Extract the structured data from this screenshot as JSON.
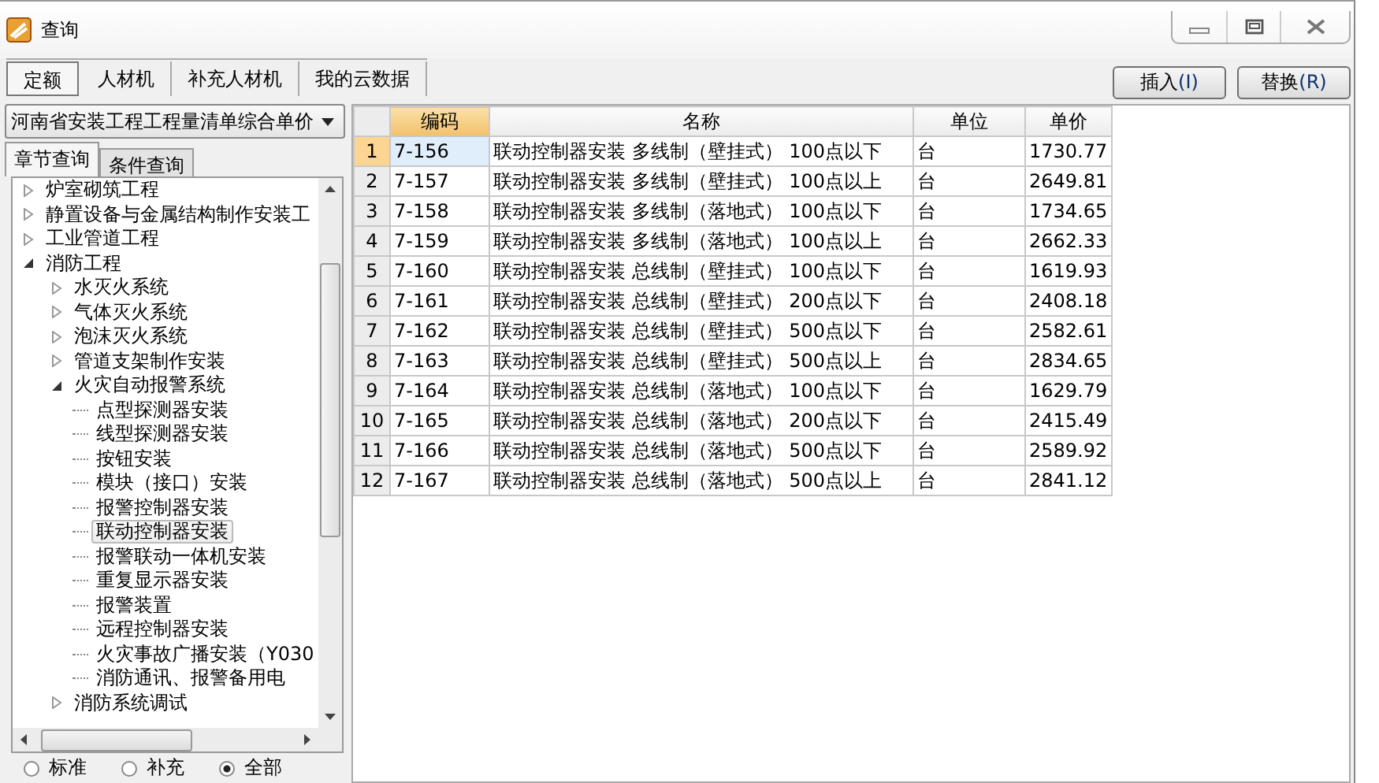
{
  "window": {
    "title": "查询"
  },
  "tabs": [
    {
      "label": "定额",
      "selected": true
    },
    {
      "label": "人材机",
      "selected": false
    },
    {
      "label": "补充人材机",
      "selected": false
    },
    {
      "label": "我的云数据",
      "selected": false
    }
  ],
  "buttons": [
    {
      "label": "插入",
      "key": "(I)"
    },
    {
      "label": "替换",
      "key": "(R)"
    }
  ],
  "library": {
    "value": "河南省安装工程工程量清单综合单价"
  },
  "subtabs": [
    {
      "label": "章节查询",
      "selected": true
    },
    {
      "label": "条件查询",
      "selected": false
    }
  ],
  "tree": [
    {
      "label": "炉室砌筑工程",
      "expanded": false,
      "selected": false
    },
    {
      "label": "静置设备与金属结构制作安装工",
      "expanded": false,
      "selected": false
    },
    {
      "label": "工业管道工程",
      "expanded": false,
      "selected": false
    },
    {
      "label": "消防工程",
      "expanded": true,
      "selected": false,
      "children": [
        {
          "label": "水灭火系统",
          "expanded": false,
          "selected": false
        },
        {
          "label": "气体灭火系统",
          "expanded": false,
          "selected": false
        },
        {
          "label": "泡沫灭火系统",
          "expanded": false,
          "selected": false
        },
        {
          "label": "管道支架制作安装",
          "expanded": false,
          "selected": false
        },
        {
          "label": "火灾自动报警系统",
          "expanded": true,
          "selected": false,
          "children": [
            {
              "label": "点型探测器安装",
              "selected": false
            },
            {
              "label": "线型探测器安装",
              "selected": false
            },
            {
              "label": "按钮安装",
              "selected": false
            },
            {
              "label": "模块（接口）安装",
              "selected": false
            },
            {
              "label": "报警控制器安装",
              "selected": false
            },
            {
              "label": "联动控制器安装",
              "selected": true
            },
            {
              "label": "报警联动一体机安装",
              "selected": false
            },
            {
              "label": "重复显示器安装",
              "selected": false
            },
            {
              "label": "报警装置",
              "selected": false
            },
            {
              "label": "远程控制器安装",
              "selected": false
            },
            {
              "label": "火灾事故广播安装（Y030",
              "selected": false
            },
            {
              "label": "消防通讯、报警备用电",
              "selected": false
            }
          ]
        },
        {
          "label": "消防系统调试",
          "expanded": false,
          "selected": false
        }
      ]
    }
  ],
  "filters": [
    {
      "label": "标准",
      "selected": false
    },
    {
      "label": "补充",
      "selected": false
    },
    {
      "label": "全部",
      "selected": true
    }
  ],
  "table": {
    "columns": [
      {
        "label": "编码",
        "selected": true
      },
      {
        "label": "名称",
        "selected": false
      },
      {
        "label": "单位",
        "selected": false
      },
      {
        "label": "单价",
        "selected": false
      }
    ],
    "rows": [
      {
        "num": "1",
        "code": "7-156",
        "name": "联动控制器安装  多线制（壁挂式） 100点以下",
        "unit": "台",
        "price": "1730.77",
        "selected": true
      },
      {
        "num": "2",
        "code": "7-157",
        "name": "联动控制器安装  多线制（壁挂式） 100点以上",
        "unit": "台",
        "price": "2649.81",
        "selected": false
      },
      {
        "num": "3",
        "code": "7-158",
        "name": "联动控制器安装  多线制（落地式） 100点以下",
        "unit": "台",
        "price": "1734.65",
        "selected": false
      },
      {
        "num": "4",
        "code": "7-159",
        "name": "联动控制器安装  多线制（落地式） 100点以上",
        "unit": "台",
        "price": "2662.33",
        "selected": false
      },
      {
        "num": "5",
        "code": "7-160",
        "name": "联动控制器安装  总线制（壁挂式） 100点以下",
        "unit": "台",
        "price": "1619.93",
        "selected": false
      },
      {
        "num": "6",
        "code": "7-161",
        "name": "联动控制器安装  总线制（壁挂式） 200点以下",
        "unit": "台",
        "price": "2408.18",
        "selected": false
      },
      {
        "num": "7",
        "code": "7-162",
        "name": "联动控制器安装  总线制（壁挂式） 500点以下",
        "unit": "台",
        "price": "2582.61",
        "selected": false
      },
      {
        "num": "8",
        "code": "7-163",
        "name": "联动控制器安装  总线制（壁挂式） 500点以上",
        "unit": "台",
        "price": "2834.65",
        "selected": false
      },
      {
        "num": "9",
        "code": "7-164",
        "name": "联动控制器安装  总线制（落地式） 100点以下",
        "unit": "台",
        "price": "1629.79",
        "selected": false
      },
      {
        "num": "10",
        "code": "7-165",
        "name": "联动控制器安装  总线制（落地式） 200点以下",
        "unit": "台",
        "price": "2415.49",
        "selected": false
      },
      {
        "num": "11",
        "code": "7-166",
        "name": "联动控制器安装  总线制（落地式） 500点以下",
        "unit": "台",
        "price": "2589.92",
        "selected": false
      },
      {
        "num": "12",
        "code": "7-167",
        "name": "联动控制器安装  总线制（落地式） 500点以上",
        "unit": "台",
        "price": "2841.12",
        "selected": false
      }
    ]
  }
}
